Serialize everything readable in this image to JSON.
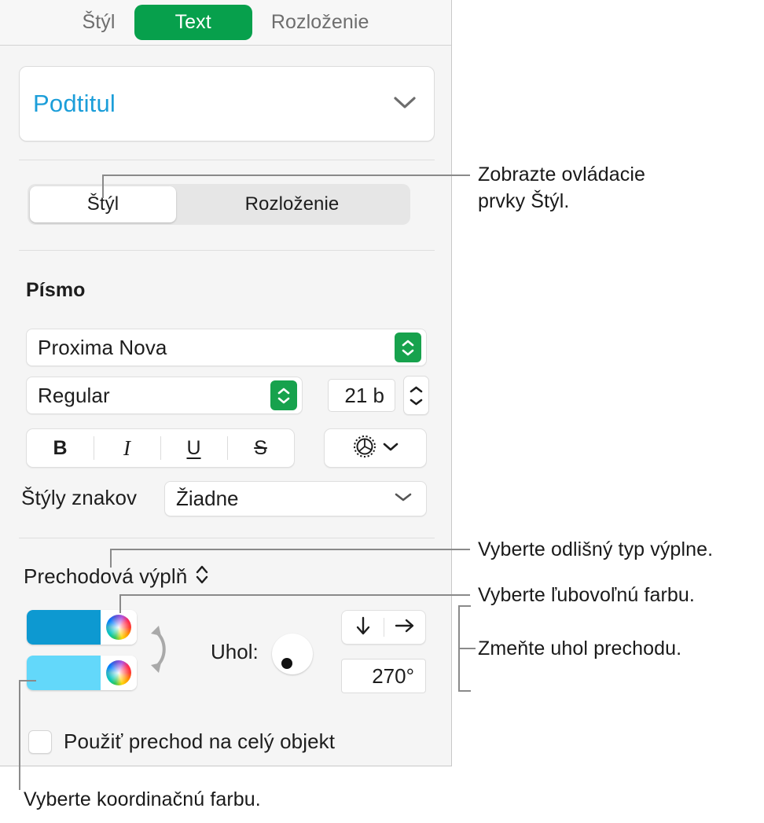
{
  "panel": {
    "tabs": [
      {
        "label": "Štýl",
        "active": false
      },
      {
        "label": "Text",
        "active": true
      },
      {
        "label": "Rozloženie",
        "active": false
      }
    ],
    "paragraph_style": {
      "value": "Podtitul",
      "chevron": "chevron-down-icon"
    },
    "segmented": [
      {
        "label": "Štýl",
        "selected": true
      },
      {
        "label": "Rozloženie",
        "selected": false
      }
    ],
    "font_section": {
      "title": "Písmo",
      "family": "Proxima Nova",
      "weight": "Regular",
      "size": "21 b"
    },
    "format_buttons": [
      {
        "label": "B",
        "name": "bold-button"
      },
      {
        "label": "I",
        "name": "italic-button"
      },
      {
        "label": "U",
        "name": "underline-button"
      },
      {
        "label": "S",
        "name": "strikethrough-button"
      }
    ],
    "gear_button": {
      "icon": "gear-icon",
      "chevron": "chevron-down-icon"
    },
    "character_styles": {
      "label": "Štýly znakov",
      "value": "Žiadne"
    },
    "fill": {
      "type_label": "Prechodová výplň",
      "start_color": "#0d99d1",
      "end_color": "#63d8fa",
      "swap_icon": "swap-arrows-icon",
      "angle_label": "Uhol:",
      "angle_value": "270°",
      "direction_down_icon": "arrow-down-icon",
      "direction_right_icon": "arrow-right-icon"
    },
    "checkbox": {
      "label": "Použiť prechod na celý objekt",
      "checked": false
    }
  },
  "callouts": {
    "style_controls": "Zobrazte ovládacie\nprvky Štýl.",
    "fill_type": "Vyberte odlišný typ výplne.",
    "any_color": "Vyberte ľubovoľnú farbu.",
    "gradient_angle": "Zmeňte uhol prechodu.",
    "coordinating_color": "Vyberte koordinačnú farbu."
  },
  "colors": {
    "accent_green": "#07a04c",
    "link_blue": "#1c9ed9",
    "panel_bg": "#f5f5f5",
    "leader_gray": "#8a8a8a"
  }
}
